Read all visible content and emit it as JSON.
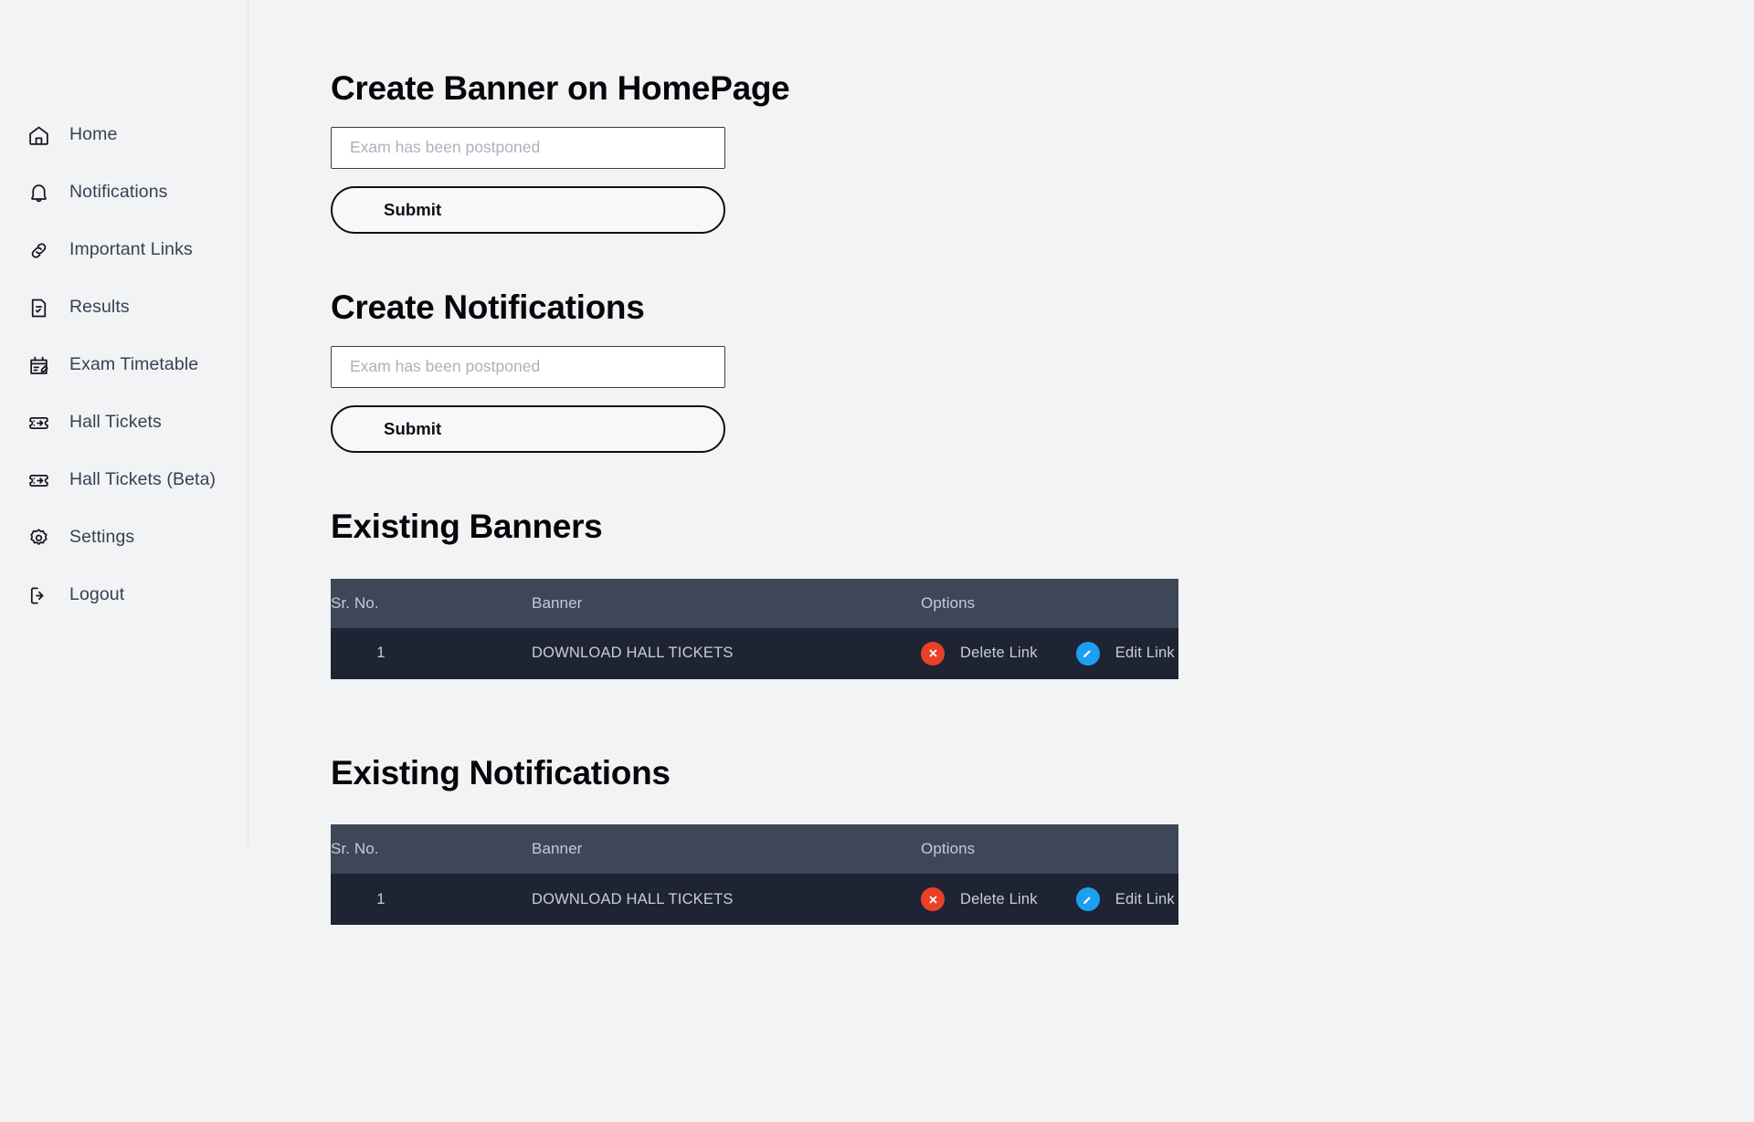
{
  "theme": {
    "page_bg": "#f2f3f5",
    "sidebar_border": "#e2e5ea",
    "table_header_bg": "#3d4757",
    "table_row_bg": "#1e2433",
    "delete_badge": "#ea4028",
    "edit_badge": "#1c9ff0",
    "heading_color": "#05070a"
  },
  "sidebar": {
    "items": [
      {
        "label": "Home",
        "icon": "home-icon"
      },
      {
        "label": "Notifications",
        "icon": "bell-icon"
      },
      {
        "label": "Important Links",
        "icon": "link-icon"
      },
      {
        "label": "Results",
        "icon": "document-grade-icon"
      },
      {
        "label": "Exam Timetable",
        "icon": "calendar-edit-icon"
      },
      {
        "label": "Hall Tickets",
        "icon": "ticket-icon"
      },
      {
        "label": "Hall Tickets (Beta)",
        "icon": "ticket-icon"
      },
      {
        "label": "Settings",
        "icon": "gear-icon"
      },
      {
        "label": "Logout",
        "icon": "logout-icon"
      }
    ]
  },
  "main": {
    "create_banner": {
      "title": "Create Banner on HomePage",
      "input_placeholder": "Exam has been postponed",
      "input_value": "",
      "submit_label": "Submit"
    },
    "create_notifications": {
      "title": "Create Notifications",
      "input_placeholder": "Exam has been postponed",
      "input_value": "",
      "submit_label": "Submit"
    },
    "existing_banners": {
      "title": "Existing Banners",
      "columns": [
        "Sr. No.",
        "Banner",
        "Options"
      ],
      "rows": [
        {
          "sr_no": "1",
          "banner": "DOWNLOAD HALL TICKETS",
          "delete_label": "Delete Link",
          "edit_label": "Edit Link"
        }
      ]
    },
    "existing_notifications": {
      "title": "Existing Notifications",
      "columns": [
        "Sr. No.",
        "Banner",
        "Options"
      ],
      "rows": [
        {
          "sr_no": "1",
          "banner": "DOWNLOAD HALL TICKETS",
          "delete_label": "Delete Link",
          "edit_label": "Edit Link"
        }
      ]
    }
  }
}
